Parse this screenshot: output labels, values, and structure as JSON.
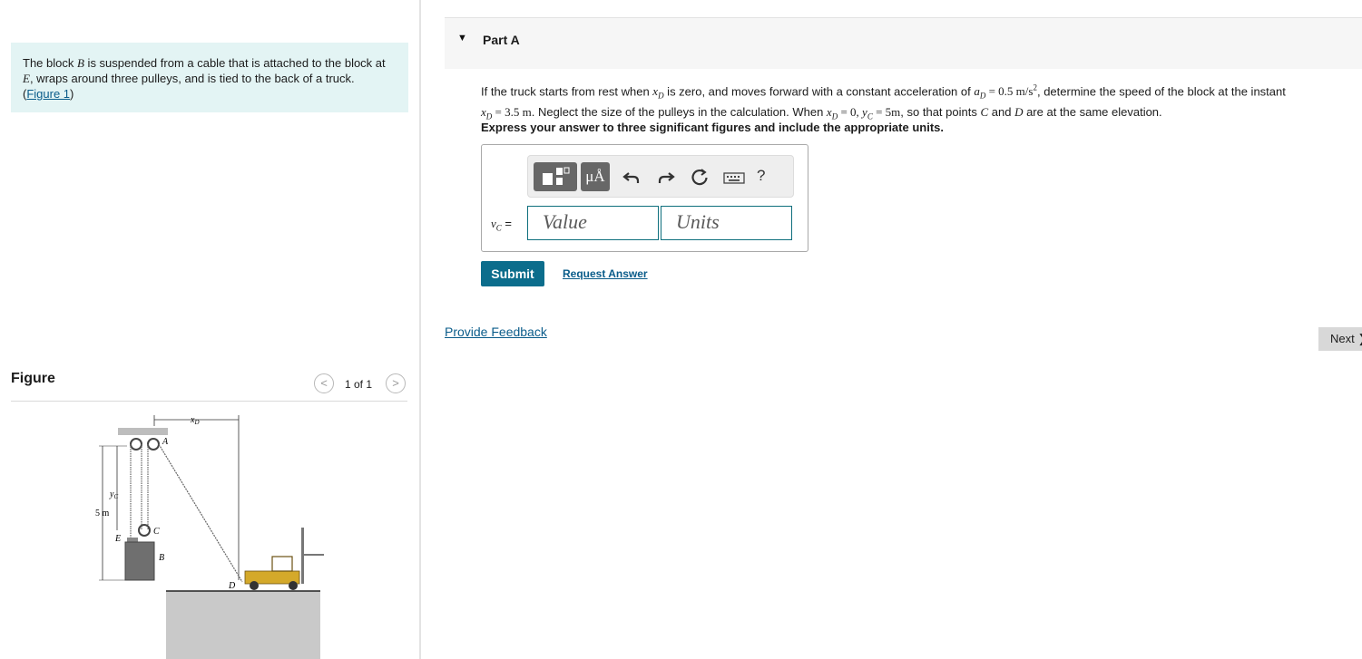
{
  "intro": {
    "text1": "The block ",
    "var_b": "B",
    "text2": " is suspended from a cable that is attached to the block at",
    "var_e": "E",
    "text3": ", wraps around three pulleys, and is tied to the back of a truck.",
    "figure_link_open": "(",
    "figure_link": "Figure 1",
    "figure_link_close": ")"
  },
  "figure": {
    "title": "Figure",
    "counter": "1 of 1",
    "prev_glyph": "<",
    "next_glyph": ">",
    "labels": {
      "xd": "x",
      "xd_sub": "D",
      "a": "A",
      "yc": "y",
      "yc_sub": "C",
      "five_m": "5 m",
      "c": "C",
      "e": "E",
      "b": "B",
      "d": "D"
    }
  },
  "part": {
    "caret": "▼",
    "title": "Part A"
  },
  "question": {
    "s1": "If the truck starts from rest when ",
    "xd": "x",
    "xd_sub": "D",
    "s2": " is zero, and moves forward with a constant acceleration of ",
    "ad": "a",
    "ad_sub": "D",
    "ad_val": " = 0.5 m/s",
    "ad_exp": "2",
    "s3": ", determine the speed of the block at the instant",
    "xd2": "x",
    "xd2_sub": "D",
    "xd2_val": " = 3.5 m",
    "s4": ". Neglect the size of the pulleys in the calculation. When ",
    "xd3": "x",
    "xd3_sub": "D",
    "xd3_val": " = 0, ",
    "yc": "y",
    "yc_sub": "C",
    "yc_val": " = 5m",
    "s5": ", so that points ",
    "c": "C",
    "s6": " and ",
    "d": "D",
    "s7": " are at the same elevation."
  },
  "instruction": "Express your answer to three significant figures and include the appropriate units.",
  "answer": {
    "var_main": "v",
    "var_sub": "C",
    "var_eq": " =",
    "value_placeholder": "Value",
    "units_placeholder": "Units",
    "toolbar": {
      "units_label": "μÅ",
      "help_label": "?",
      "icons": [
        "templates-icon",
        "units-icon",
        "undo-icon",
        "redo-icon",
        "reset-icon",
        "keyboard-icon",
        "help-icon"
      ]
    }
  },
  "actions": {
    "submit": "Submit",
    "request_answer": "Request Answer",
    "provide_feedback": "Provide Feedback",
    "next": "Next ❯"
  },
  "colors": {
    "intro_bg": "#e3f4f4",
    "link": "#0a5c8a",
    "submit_bg": "#0c6d8c",
    "field_border": "#0e6f7d",
    "truck_yellow": "#d4a92a"
  }
}
